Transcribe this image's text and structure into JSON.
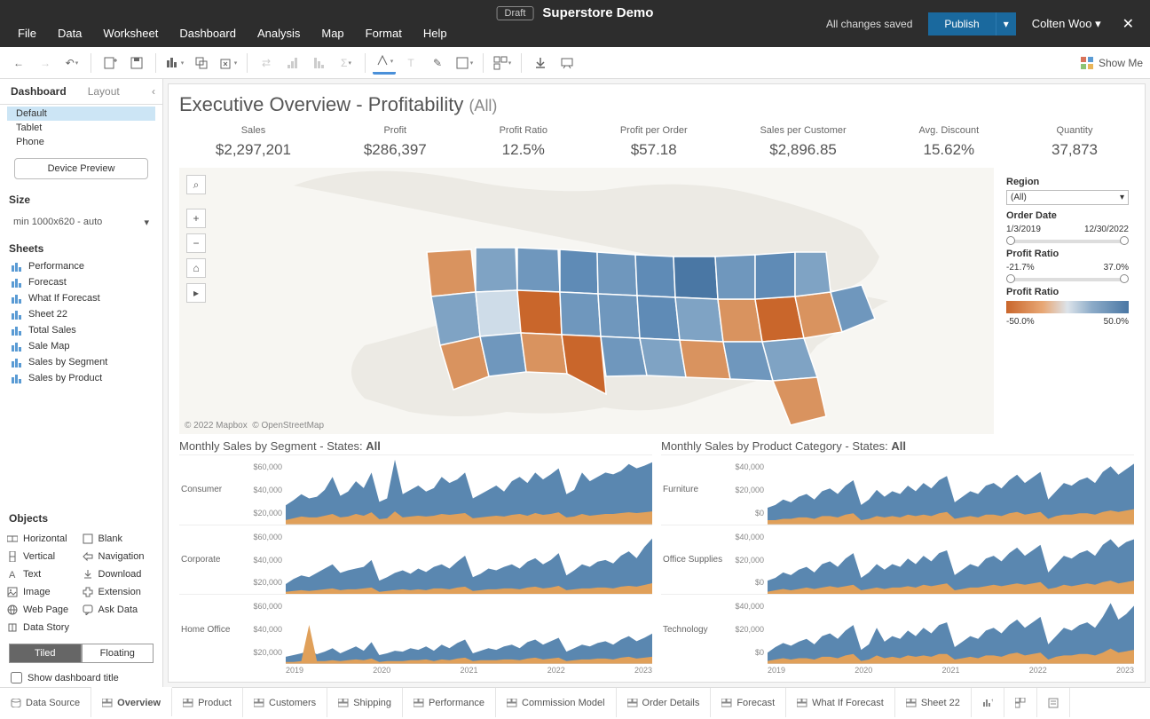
{
  "titlebar": {
    "menus": [
      "File",
      "Data",
      "Worksheet",
      "Dashboard",
      "Analysis",
      "Map",
      "Format",
      "Help"
    ],
    "draft": "Draft",
    "doc": "Superstore Demo",
    "saved": "All changes saved",
    "publish": "Publish",
    "user": "Colten Woo"
  },
  "toolbar": {
    "show_me": "Show Me"
  },
  "left": {
    "tabs": {
      "dashboard": "Dashboard",
      "layout": "Layout"
    },
    "devices": [
      "Default",
      "Tablet",
      "Phone"
    ],
    "device_preview": "Device Preview",
    "size_head": "Size",
    "size_val": "min 1000x620 - auto",
    "sheets_head": "Sheets",
    "sheets": [
      "Performance",
      "Forecast",
      "What If Forecast",
      "Sheet 22",
      "Total Sales",
      "Sale Map",
      "Sales by Segment",
      "Sales by Product"
    ],
    "objects_head": "Objects",
    "objects": [
      "Horizontal",
      "Blank",
      "Vertical",
      "Navigation",
      "Text",
      "Download",
      "Image",
      "Extension",
      "Web Page",
      "Ask Data",
      "Data Story"
    ],
    "tiled": "Tiled",
    "floating": "Floating",
    "show_title": "Show dashboard title"
  },
  "dash": {
    "title_main": "Executive Overview - Profitability ",
    "title_sub": "(All)",
    "kpis": [
      {
        "lab": "Sales",
        "val": "$2,297,201"
      },
      {
        "lab": "Profit",
        "val": "$286,397"
      },
      {
        "lab": "Profit Ratio",
        "val": "12.5%"
      },
      {
        "lab": "Profit per Order",
        "val": "$57.18"
      },
      {
        "lab": "Sales per Customer",
        "val": "$2,896.85"
      },
      {
        "lab": "Avg. Discount",
        "val": "15.62%"
      },
      {
        "lab": "Quantity",
        "val": "37,873"
      }
    ],
    "map_attrib1": "© 2022 Mapbox",
    "map_attrib2": "© OpenStreetMap",
    "filters": {
      "region": "Region",
      "region_val": "(All)",
      "order_date": "Order Date",
      "date_from": "1/3/2019",
      "date_to": "12/30/2022",
      "profit_ratio": "Profit Ratio",
      "pr_from": "-21.7%",
      "pr_to": "37.0%",
      "legend": "Profit Ratio",
      "leg_from": "-50.0%",
      "leg_to": "50.0%"
    },
    "seg_title_a": "Monthly Sales by Segment - States: ",
    "seg_title_b": "All",
    "prod_title_a": "Monthly Sales by Product Category - States: ",
    "prod_title_b": "All",
    "seg_rows": [
      "Consumer",
      "Corporate",
      "Home Office"
    ],
    "seg_axis": [
      "$60,000",
      "$40,000",
      "$20,000"
    ],
    "prod_rows": [
      "Furniture",
      "Office Supplies",
      "Technology"
    ],
    "prod_axis": [
      "$40,000",
      "$20,000",
      "$0"
    ],
    "years": [
      "2019",
      "2020",
      "2021",
      "2022",
      "2023"
    ]
  },
  "tabs": [
    "Data Source",
    "Overview",
    "Product",
    "Customers",
    "Shipping",
    "Performance",
    "Commission Model",
    "Order Details",
    "Forecast",
    "What If Forecast",
    "Sheet 22"
  ],
  "chart_data": {
    "type": "area",
    "note": "Values estimated from pixels; 48 monthly points per series (2019-2022).",
    "segments": {
      "Consumer": {
        "blue": [
          22,
          28,
          35,
          30,
          32,
          40,
          55,
          33,
          38,
          50,
          42,
          60,
          26,
          30,
          75,
          35,
          40,
          45,
          38,
          42,
          55,
          48,
          52,
          60,
          30,
          35,
          40,
          45,
          38,
          50,
          55,
          48,
          60,
          52,
          58,
          65,
          35,
          40,
          60,
          50,
          55,
          60,
          58,
          62,
          70,
          65,
          68,
          72
        ],
        "orange": [
          5,
          7,
          9,
          8,
          8,
          10,
          12,
          8,
          9,
          12,
          10,
          14,
          6,
          7,
          15,
          8,
          9,
          10,
          9,
          10,
          12,
          11,
          12,
          13,
          7,
          8,
          9,
          10,
          9,
          11,
          12,
          10,
          13,
          11,
          12,
          14,
          8,
          9,
          12,
          10,
          11,
          12,
          12,
          13,
          14,
          13,
          14,
          15
        ]
      },
      "Corporate": {
        "blue": [
          12,
          18,
          22,
          20,
          25,
          30,
          35,
          25,
          28,
          30,
          32,
          40,
          16,
          20,
          25,
          28,
          24,
          30,
          26,
          32,
          35,
          30,
          38,
          45,
          20,
          24,
          30,
          28,
          32,
          35,
          30,
          38,
          42,
          35,
          40,
          48,
          22,
          28,
          35,
          32,
          38,
          40,
          36,
          45,
          50,
          42,
          55,
          65
        ],
        "orange": [
          3,
          4,
          5,
          4,
          5,
          6,
          7,
          5,
          6,
          6,
          7,
          8,
          3,
          4,
          5,
          6,
          5,
          6,
          5,
          7,
          7,
          6,
          8,
          9,
          4,
          5,
          6,
          6,
          7,
          7,
          6,
          8,
          9,
          7,
          8,
          10,
          5,
          6,
          7,
          7,
          8,
          8,
          7,
          9,
          10,
          9,
          11,
          13
        ]
      },
      "Home Office": {
        "blue": [
          8,
          10,
          12,
          15,
          11,
          14,
          18,
          12,
          16,
          20,
          15,
          25,
          10,
          12,
          15,
          14,
          18,
          16,
          20,
          15,
          22,
          18,
          24,
          28,
          12,
          15,
          18,
          16,
          20,
          22,
          18,
          25,
          28,
          22,
          26,
          30,
          14,
          18,
          22,
          20,
          24,
          26,
          22,
          28,
          32,
          26,
          30,
          35
        ],
        "orange": [
          2,
          2,
          3,
          45,
          3,
          3,
          4,
          3,
          4,
          5,
          4,
          6,
          2,
          3,
          3,
          3,
          4,
          4,
          5,
          3,
          5,
          4,
          6,
          7,
          3,
          4,
          4,
          4,
          5,
          5,
          4,
          6,
          7,
          5,
          6,
          7,
          3,
          4,
          5,
          5,
          6,
          6,
          5,
          7,
          8,
          6,
          7,
          8
        ]
      }
    },
    "products": {
      "Furniture": {
        "blue": [
          12,
          14,
          18,
          16,
          20,
          22,
          18,
          24,
          26,
          22,
          28,
          32,
          14,
          18,
          25,
          20,
          24,
          22,
          28,
          24,
          30,
          26,
          32,
          35,
          16,
          20,
          24,
          22,
          28,
          30,
          26,
          32,
          36,
          30,
          34,
          38,
          18,
          24,
          30,
          28,
          32,
          34,
          30,
          38,
          42,
          36,
          40,
          44
        ],
        "orange": [
          3,
          3,
          4,
          4,
          5,
          5,
          4,
          6,
          6,
          5,
          7,
          8,
          3,
          4,
          6,
          5,
          6,
          5,
          7,
          6,
          7,
          6,
          8,
          9,
          4,
          5,
          6,
          5,
          7,
          7,
          6,
          8,
          9,
          7,
          8,
          9,
          4,
          6,
          7,
          7,
          8,
          8,
          7,
          9,
          10,
          9,
          10,
          11
        ]
      },
      "Office Supplies": {
        "blue": [
          10,
          12,
          16,
          14,
          18,
          20,
          16,
          22,
          24,
          20,
          26,
          30,
          12,
          16,
          22,
          18,
          22,
          20,
          26,
          22,
          28,
          24,
          30,
          32,
          14,
          18,
          22,
          20,
          26,
          28,
          24,
          30,
          34,
          28,
          32,
          36,
          16,
          22,
          28,
          26,
          30,
          32,
          28,
          36,
          40,
          34,
          38,
          40
        ],
        "orange": [
          2,
          3,
          4,
          3,
          4,
          5,
          4,
          5,
          6,
          5,
          6,
          7,
          3,
          4,
          5,
          4,
          5,
          5,
          6,
          5,
          7,
          6,
          7,
          8,
          3,
          4,
          5,
          5,
          6,
          7,
          6,
          7,
          8,
          7,
          8,
          9,
          4,
          5,
          7,
          6,
          7,
          8,
          7,
          9,
          10,
          8,
          9,
          10
        ]
      },
      "Technology": {
        "blue": [
          8,
          12,
          15,
          13,
          16,
          18,
          14,
          20,
          22,
          18,
          24,
          28,
          10,
          14,
          26,
          16,
          20,
          18,
          24,
          20,
          26,
          22,
          28,
          30,
          12,
          16,
          20,
          18,
          24,
          26,
          22,
          28,
          32,
          26,
          30,
          34,
          14,
          20,
          26,
          24,
          28,
          30,
          26,
          34,
          44,
          32,
          36,
          42
        ],
        "orange": [
          2,
          3,
          4,
          3,
          4,
          4,
          3,
          5,
          5,
          4,
          6,
          7,
          2,
          3,
          6,
          4,
          5,
          4,
          6,
          5,
          6,
          5,
          7,
          7,
          3,
          4,
          5,
          4,
          6,
          6,
          5,
          7,
          8,
          6,
          7,
          8,
          3,
          5,
          6,
          6,
          7,
          7,
          6,
          8,
          11,
          8,
          9,
          10
        ]
      }
    }
  }
}
